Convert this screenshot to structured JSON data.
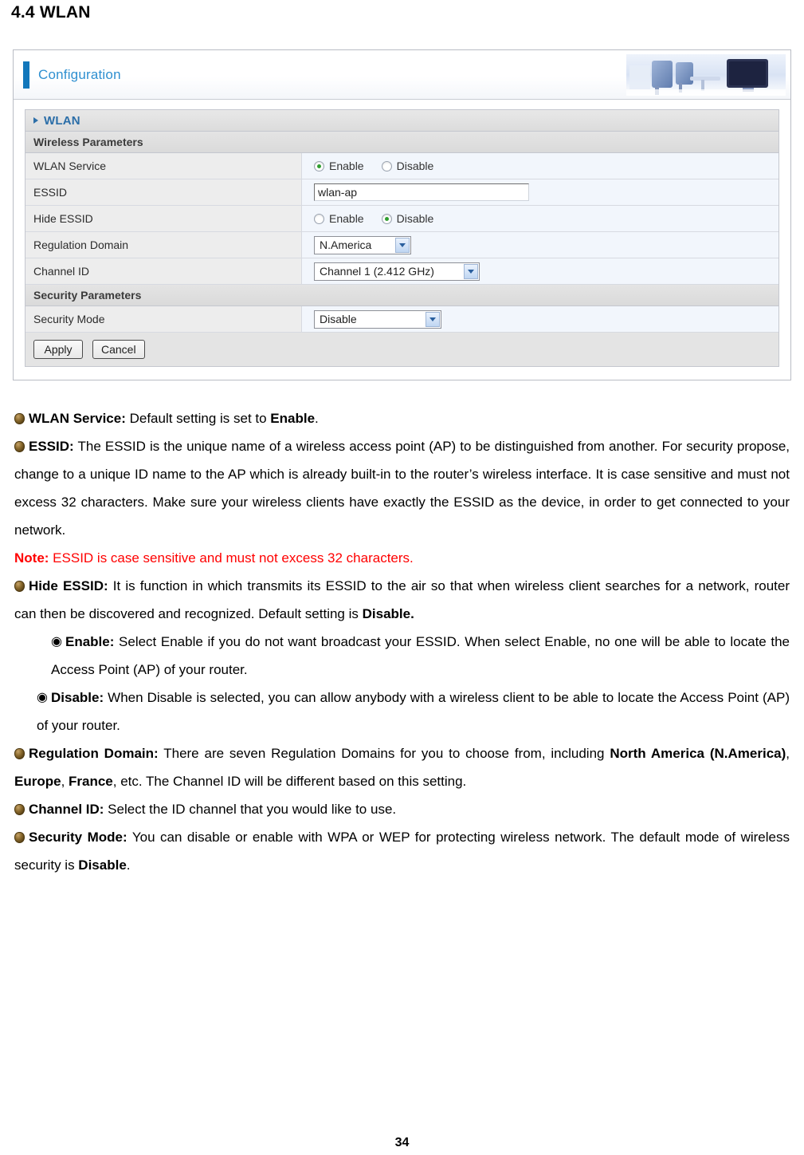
{
  "heading": "4.4 WLAN",
  "screenshot": {
    "header_title": "Configuration",
    "section_title": "WLAN",
    "groups": {
      "wireless": "Wireless Parameters",
      "security": "Security Parameters"
    },
    "rows": {
      "wlan_service": {
        "label": "WLAN Service",
        "options": [
          "Enable",
          "Disable"
        ],
        "selected": "Enable"
      },
      "essid": {
        "label": "ESSID",
        "value": "wlan-ap"
      },
      "hide_essid": {
        "label": "Hide ESSID",
        "options": [
          "Enable",
          "Disable"
        ],
        "selected": "Disable"
      },
      "regulation_domain": {
        "label": "Regulation Domain",
        "value": "N.America"
      },
      "channel_id": {
        "label": "Channel ID",
        "value": "Channel 1 (2.412 GHz)"
      },
      "security_mode": {
        "label": "Security Mode",
        "value": "Disable"
      }
    },
    "buttons": {
      "apply": "Apply",
      "cancel": "Cancel"
    }
  },
  "body": {
    "wlan_service": {
      "term": "WLAN Service:",
      "text_1": " Default setting is set to ",
      "strong_1": "Enable",
      "text_2": "."
    },
    "essid": {
      "term": "ESSID:",
      "text": " The ESSID is the unique name of a wireless access point (AP) to be distinguished from another. For security propose, change to a unique ID name to the AP which is already built-in to the router’s wireless interface. It is case sensitive and must not excess 32 characters. Make sure your wireless clients have exactly the ESSID as the device, in order to get connected to your network."
    },
    "note": {
      "label": "Note:",
      "text": " ESSID is case sensitive and must not excess 32 characters."
    },
    "hide_essid": {
      "term": "Hide ESSID:",
      "text_1": " It is function in which transmits its ESSID to the air so that when wireless client searches for a network, router can then be discovered and recognized. Default setting is ",
      "strong_1": "Disable."
    },
    "hide_essid_enable": {
      "term": "Enable:",
      "text": " Select Enable if you do not want broadcast your ESSID. When select Enable, no one will be able to locate the Access Point (AP) of your router."
    },
    "hide_essid_disable": {
      "term": "Disable:",
      "text": " When Disable is selected, you can allow anybody with a wireless client to be able to locate the Access Point (AP) of your router."
    },
    "regulation_domain": {
      "term": "Regulation Domain:",
      "text_1": " There are seven Regulation Domains for you to choose from, including ",
      "strong_1": "North America (N.America)",
      "text_2": ", ",
      "strong_2": "Europe",
      "text_3": ", ",
      "strong_3": "France",
      "text_4": ", etc. The Channel ID will be different based on this setting."
    },
    "channel_id": {
      "term": "Channel ID:",
      "text": " Select the ID channel that you would like to use."
    },
    "security_mode": {
      "term": "Security Mode:",
      "text_1": " You can disable or enable with WPA or WEP for protecting wireless network. The default mode of wireless security is ",
      "strong_1": "Disable",
      "text_2": "."
    }
  },
  "footer": {
    "page_number": "34"
  },
  "icons": {
    "sub_bullet": "◉"
  }
}
